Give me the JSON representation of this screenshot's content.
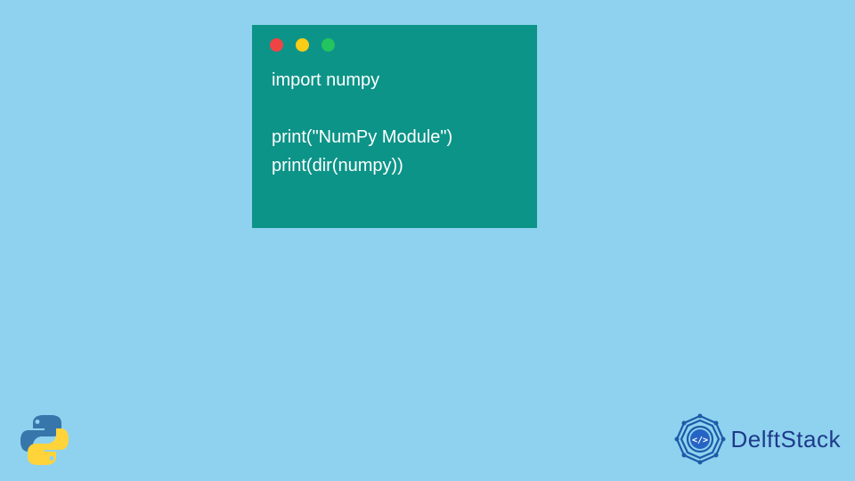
{
  "code": {
    "line1": "import numpy",
    "line2": "",
    "line3": "print(\"NumPy Module\")",
    "line4": "print(dir(numpy))"
  },
  "branding": {
    "site_name": "DelftStack"
  },
  "icons": {
    "python": "python-logo",
    "delftstack": "delftstack-logo"
  },
  "colors": {
    "background": "#8ed2ef",
    "code_bg": "#0d9488",
    "code_text": "#ffffff",
    "brand_blue": "#1e3a8a"
  }
}
